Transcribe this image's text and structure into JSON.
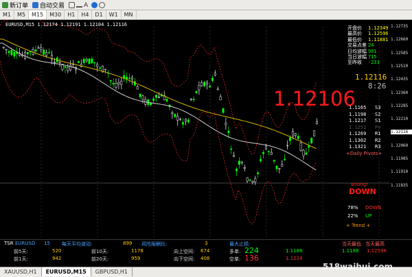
{
  "toolbar": {
    "new_order": "新订单",
    "auto_trade": "自动交易"
  },
  "timeframes": [
    "M1",
    "M5",
    "M15",
    "M30",
    "H1",
    "H4",
    "D1",
    "W1",
    "MN"
  ],
  "active_tf": "M15",
  "chart": {
    "symbol_title": "EURUSD,M15  1.12174 1.12191 1.12104 1.12116",
    "big_price": "1.12106",
    "cur_price": "1.12116",
    "timer": "8:26",
    "y_ticks": [
      "1.12735",
      "1.12660",
      "1.12585",
      "1.12510",
      "1.12435",
      "1.12360",
      "1.12285",
      "1.12210",
      "1.12116",
      "1.12060",
      "1.11985",
      "1.11910",
      "1.11835"
    ],
    "x_ticks": [
      "18 Mar 2016",
      "21 Mar 22:15",
      "21 Mar 23:45",
      "22 Mar 02:15",
      "22 Mar 04:15",
      "22 Mar 06:15",
      "22 Mar 08:15",
      "22 Mar 10:15",
      "22 Mar 12:15",
      "22 Mar 14:15"
    ]
  },
  "info": [
    {
      "label": "开盘价",
      "value": "1.12349"
    },
    {
      "label": "最高价",
      "value": "1.12596"
    },
    {
      "label": "最低价",
      "value": "1.11881"
    },
    {
      "label": "交易点差",
      "value": "24"
    },
    {
      "label": "日均波幅",
      "value": "901"
    },
    {
      "label": "当日波幅",
      "value": "715"
    },
    {
      "label": "至昨收",
      "value": "-233"
    }
  ],
  "pivots": [
    {
      "value": "1.1165",
      "name": "S3"
    },
    {
      "value": "1.1198",
      "name": "S2"
    },
    {
      "value": "1.1217",
      "name": "S1"
    },
    {
      "value": "1.1251",
      "name": "PV"
    },
    {
      "value": "1.1269",
      "name": "R1"
    },
    {
      "value": "1.1302",
      "name": "R2"
    },
    {
      "value": "1.1321",
      "name": "R3"
    }
  ],
  "daily_pivots": "+Daily Pivots+",
  "strength": "strong!",
  "down_label": "DOWN",
  "down_pct": {
    "pct": "78%",
    "label": "DOWN"
  },
  "up_pct": {
    "pct": "22%",
    "label": "UP"
  },
  "trend_label": "+ Trend +",
  "sub": {
    "tsr": "TSR",
    "symbol": "EURUSD",
    "period": "15",
    "avg_label": "每天平均波动:",
    "avg_val": "899",
    "risk_label": "风险报酬比:",
    "risk_val": "3",
    "max_stop_label": "最大止损:",
    "rows": [
      {
        "l1": "前5天:",
        "v1": "520",
        "l2": "前10天:",
        "v2": "1178",
        "l3": "向上空间:",
        "v3": "674",
        "l4": "多单:",
        "v4": "224",
        "l5": "1.1188"
      },
      {
        "l1": "前1天:",
        "v1": "942",
        "l2": "前20天:",
        "v2": "959",
        "l3": "向下空间:",
        "v3": "408",
        "l4": "空单:",
        "v4": "136",
        "l5": "1.1224"
      }
    ],
    "r_labels": [
      "当天最低",
      "当天最高"
    ],
    "r_vals": [
      "1.1188",
      "1.12596"
    ]
  },
  "tabs": [
    "XAUUSD,H1",
    "EURUSD,M15",
    "GBPUSD,H1"
  ],
  "active_tab": "EURUSD,M15",
  "watermark": "518waihui.com",
  "colors": {
    "bull": "#00ff00",
    "bear": "#ffffff",
    "ma_slow": "#d4b800",
    "ma_fast": "#d0d0d0",
    "band": "#ff2a2a",
    "accent_red": "#ff1a1a",
    "price_yellow": "#ffcc00"
  }
}
